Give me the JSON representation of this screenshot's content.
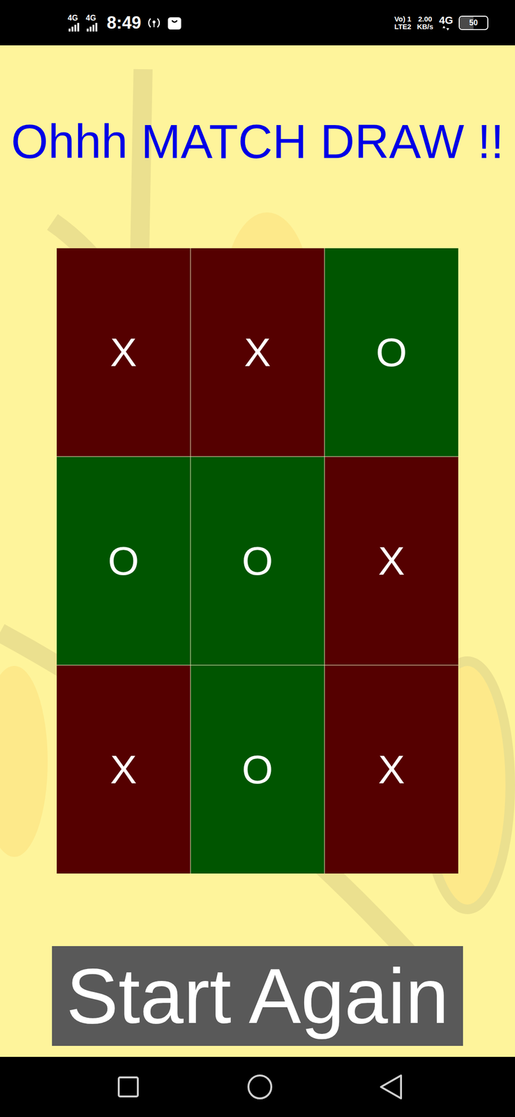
{
  "status_bar": {
    "network": [
      "4G",
      "4G"
    ],
    "time": "8:49",
    "volte": "Vo) 1",
    "lte": "LTE2",
    "speed": "2.00",
    "speed_unit": "KB/s",
    "data_network": "4G",
    "battery": "50",
    "battery_level": 0.5
  },
  "title": "Ohhh MATCH DRAW !!",
  "board": {
    "cells": [
      {
        "mark": "X",
        "color": "#550000"
      },
      {
        "mark": "X",
        "color": "#550000"
      },
      {
        "mark": "O",
        "color": "#005500"
      },
      {
        "mark": "O",
        "color": "#005500"
      },
      {
        "mark": "O",
        "color": "#005500"
      },
      {
        "mark": "X",
        "color": "#550000"
      },
      {
        "mark": "X",
        "color": "#550000"
      },
      {
        "mark": "O",
        "color": "#005500"
      },
      {
        "mark": "X",
        "color": "#550000"
      }
    ]
  },
  "button": "Start Again"
}
